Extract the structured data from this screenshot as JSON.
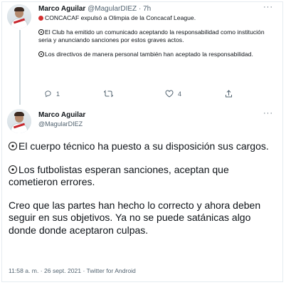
{
  "tweet1": {
    "author_name": "Marco Aguilar",
    "author_handle": "@MagularDIEZ",
    "separator": "·",
    "time": "7h",
    "more": "···",
    "line0": "CONCACAF expulsó a Olimpia de la Concacaf League.",
    "para1": "El Club ha emitido un comunicado aceptando la responsabilidad como institución seria y anunciando sanciones por estos graves actos.",
    "para2": "Los directivos de manera personal también han aceptado la responsabilidad.",
    "reply_count": "1",
    "retweet_count": "",
    "like_count": "4"
  },
  "tweet2": {
    "author_name": "Marco Aguilar",
    "author_handle": "@MagularDIEZ",
    "more": "···",
    "para1": "El cuerpo técnico ha puesto a su disposición sus cargos.",
    "para2": "Los futbolistas esperan sanciones, aceptan que cometieron errores.",
    "para3": "Creo que las partes han hecho lo correcto y ahora deben seguir en sus objetivos. Ya no se puede satánicas algo donde donde aceptaron culpas.",
    "meta": "11:58 a. m. · 26 sept. 2021 · Twitter for Android"
  },
  "icons": {
    "red_circle": "large-red-circle-emoji",
    "soccer_ball": "soccer-ball-emoji",
    "reply": "reply-icon",
    "retweet": "retweet-icon",
    "like": "heart-icon",
    "share": "share-icon",
    "more": "more-icon"
  },
  "colors": {
    "text": "#0f1419",
    "muted": "#536471",
    "border": "#e6ecf0",
    "thread_line": "#cfd9de",
    "red": "#d32f2f"
  }
}
